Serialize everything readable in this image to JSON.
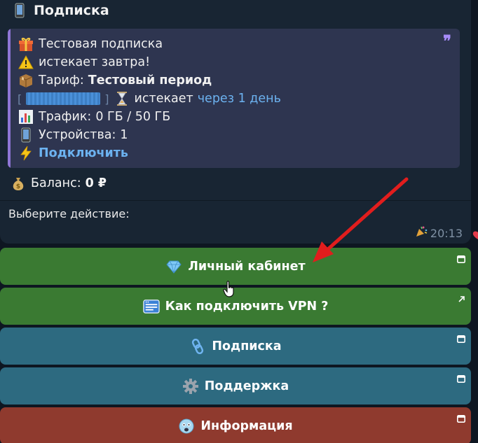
{
  "header": {
    "title": "Подписка",
    "icon": "phone-icon"
  },
  "subscription": {
    "name": "Тестовая подписка",
    "expiry_warning": "истекает завтра!",
    "tariff_label": "Тариф:",
    "tariff_value": "Тестовый период",
    "expires_label": "истекает",
    "expires_link": "через 1 день",
    "traffic_label": "Трафик:",
    "traffic_value": "0 ГБ / 50 ГБ",
    "devices_label": "Устройства:",
    "devices_value": "1",
    "connect_label": "Подключить"
  },
  "balance": {
    "label": "Баланс:",
    "value": "0 ₽"
  },
  "prompt": "Выберите действие:",
  "timestamp": "20:13",
  "buttons": [
    {
      "label": "Личный кабинет",
      "icon": "gem-icon",
      "color": "#3a7a32",
      "corner": "webapp-icon"
    },
    {
      "label": "Как подключить VPN ?",
      "icon": "browser-window-icon",
      "color": "#3a7a32",
      "corner": "external-link-icon"
    },
    {
      "label": "Подписка",
      "icon": "link-icon",
      "color": "#2d6a80",
      "corner": "webapp-icon"
    },
    {
      "label": "Поддержка",
      "icon": "gear-icon",
      "color": "#2d6a80",
      "corner": "webapp-icon"
    },
    {
      "label": "Информация",
      "icon": "info-face-icon",
      "color": "#8f3a2e",
      "corner": "webapp-icon"
    }
  ],
  "colors": {
    "background": "#0e1621",
    "bubble": "#182533",
    "quote": "#2e3550",
    "link": "#6cb2f0",
    "annotation_arrow": "#e11d1d"
  }
}
